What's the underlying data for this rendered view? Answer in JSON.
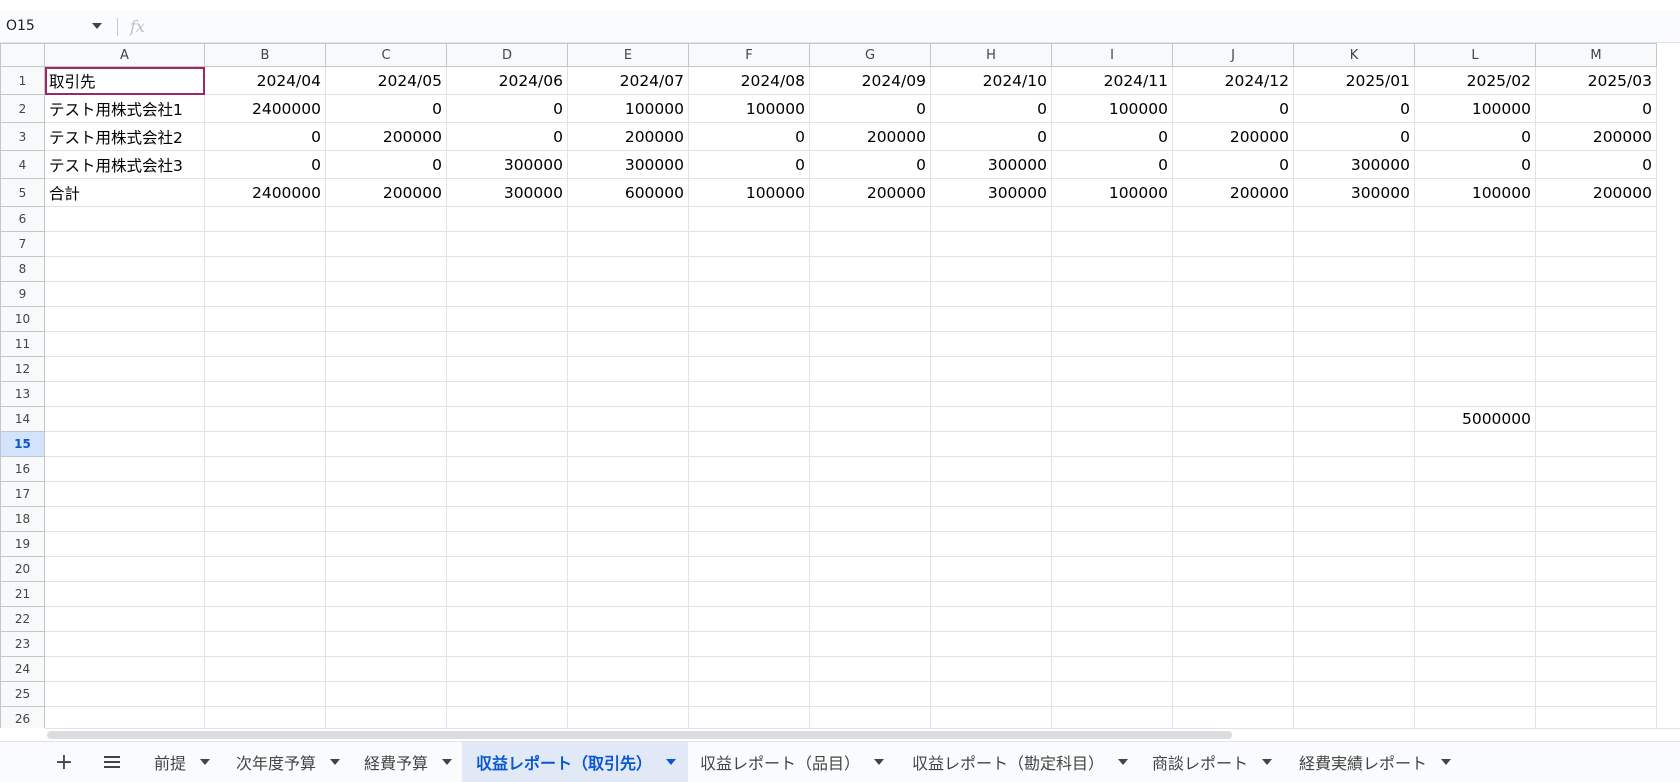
{
  "formula_bar": {
    "name_box": "O15",
    "fx_label": "fx"
  },
  "columns": [
    "A",
    "B",
    "C",
    "D",
    "E",
    "F",
    "G",
    "H",
    "I",
    "J",
    "K",
    "L",
    "M"
  ],
  "rows": [
    [
      "取引先",
      "2024/04",
      "2024/05",
      "2024/06",
      "2024/07",
      "2024/08",
      "2024/09",
      "2024/10",
      "2024/11",
      "2024/12",
      "2025/01",
      "2025/02",
      "2025/03"
    ],
    [
      "テスト用株式会社1",
      "2400000",
      "0",
      "0",
      "100000",
      "100000",
      "0",
      "0",
      "100000",
      "0",
      "0",
      "100000",
      "0"
    ],
    [
      "テスト用株式会社2",
      "0",
      "200000",
      "0",
      "200000",
      "0",
      "200000",
      "0",
      "0",
      "200000",
      "0",
      "0",
      "200000"
    ],
    [
      "テスト用株式会社3",
      "0",
      "0",
      "300000",
      "300000",
      "0",
      "0",
      "300000",
      "0",
      "0",
      "300000",
      "0",
      "0"
    ],
    [
      "合計",
      "2400000",
      "200000",
      "300000",
      "600000",
      "100000",
      "200000",
      "300000",
      "100000",
      "200000",
      "300000",
      "100000",
      "200000"
    ]
  ],
  "extra_cells": {
    "L14": "5000000"
  },
  "row_numbers": [
    "1",
    "2",
    "3",
    "4",
    "5",
    "6",
    "7",
    "8",
    "9",
    "10",
    "11",
    "12",
    "13",
    "14",
    "15",
    "16",
    "17",
    "18",
    "19",
    "20",
    "21",
    "22",
    "23",
    "24",
    "25",
    "26"
  ],
  "active_row": "15",
  "tabs": [
    {
      "label": "前提"
    },
    {
      "label": "次年度予算"
    },
    {
      "label": "経費予算"
    },
    {
      "label": "収益レポート（取引先）",
      "active": true
    },
    {
      "label": "収益レポート（品目）"
    },
    {
      "label": "収益レポート（勘定科目）"
    },
    {
      "label": "商談レポート"
    },
    {
      "label": "経費実績レポート"
    }
  ],
  "add_sheet_label": "+",
  "colors": {
    "active_tab_bg": "#e1e9f7",
    "active_tab_text": "#0b57d0",
    "selection_outline": "#9c2766"
  }
}
